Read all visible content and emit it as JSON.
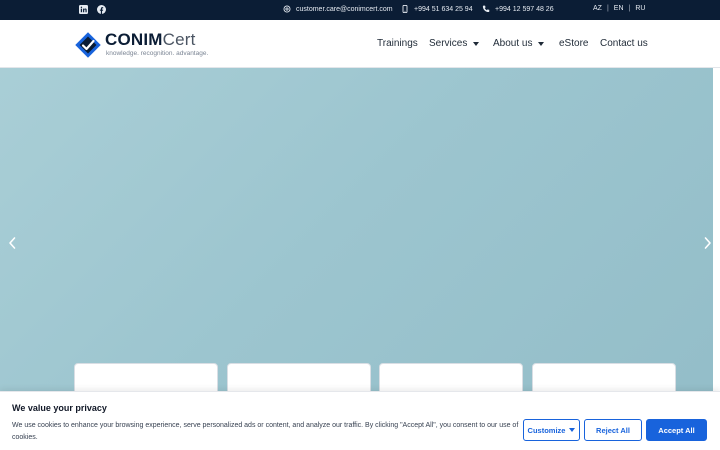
{
  "topbar": {
    "social": [
      {
        "icon": "linkedin-icon"
      },
      {
        "icon": "facebook-icon"
      }
    ],
    "email": "customer.care@conimcert.com",
    "phone_mobile": "+994 51 634 25 94",
    "phone_landline": "+994 12 597 48 26",
    "languages": [
      "AZ",
      "EN",
      "RU"
    ]
  },
  "header": {
    "logo": {
      "name_bold": "CONIM",
      "name_light": "Cert",
      "tagline": "knowledge. recognition. advantage."
    },
    "nav": [
      {
        "label": "Trainings"
      },
      {
        "label": "Services"
      },
      {
        "label": "About us"
      },
      {
        "label": "eStore"
      },
      {
        "label": "Contact us"
      }
    ]
  },
  "hero": {
    "prev_icon": "chevron-left-icon",
    "next_icon": "chevron-right-icon"
  },
  "cookie": {
    "title": "We value your privacy",
    "text": "We use cookies to enhance your browsing experience, serve personalized ads or content, and analyze our traffic. By clicking \"Accept All\", you consent to our use of cookies.",
    "customize_label": "Customize",
    "reject_label": "Reject All",
    "accept_label": "Accept All"
  },
  "colors": {
    "topbar_bg": "#0b1d35",
    "brand_blue": "#1863dc",
    "hero_bg": "#9cc5cf"
  }
}
